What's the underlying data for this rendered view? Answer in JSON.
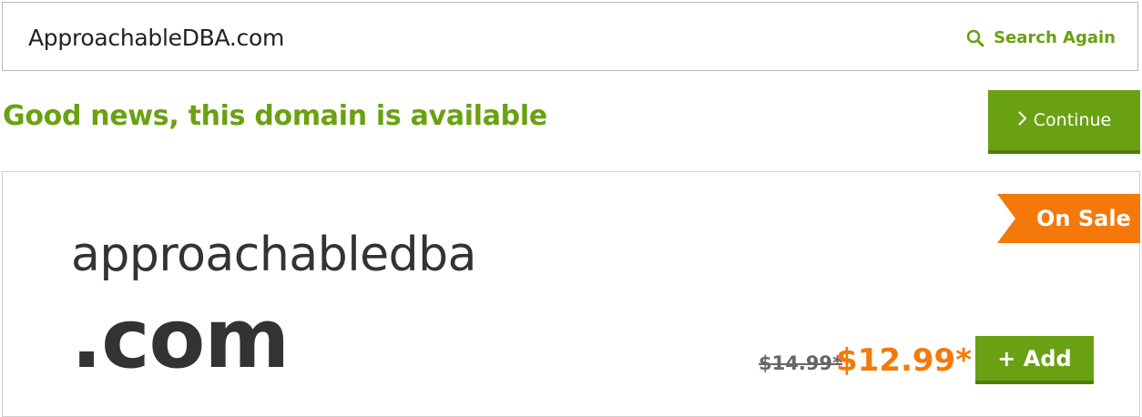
{
  "search": {
    "value": "ApproachableDBA.com",
    "again_label": "Search Again"
  },
  "status": {
    "headline": "Good news, this domain is available"
  },
  "actions": {
    "continue_label": "Continue",
    "add_label": "+ Add"
  },
  "result": {
    "domain_name": "approachabledba",
    "tld": ".com",
    "badge": "On Sale",
    "old_price": "$14.99*",
    "new_price": "$12.99*"
  },
  "colors": {
    "accent_green": "#6aa112",
    "sale_orange": "#f5780a",
    "text_dark": "#333333"
  },
  "icons": {
    "search": "search-icon",
    "continue": "chevron-right-icon"
  }
}
